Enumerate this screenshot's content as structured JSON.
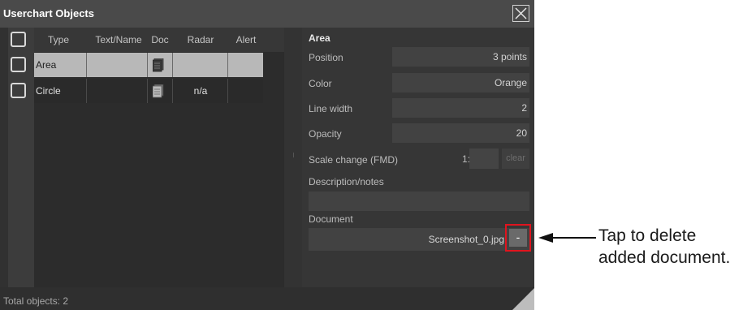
{
  "dialog": {
    "title": "Userchart Objects",
    "footer": {
      "total_label": "Total objects: 2"
    }
  },
  "table": {
    "columns": [
      "Type",
      "Text/Name",
      "Doc",
      "Radar",
      "Alert"
    ],
    "sort_indicator": "-",
    "rows": [
      {
        "type": "Area",
        "text_name": "",
        "doc_icon": "document-icon",
        "radar": "",
        "alert": "",
        "selected": true
      },
      {
        "type": "Circle",
        "text_name": "",
        "doc_icon": "document-icon",
        "radar": "n/a",
        "alert": "",
        "selected": false
      }
    ]
  },
  "details": {
    "section_title": "Area",
    "position": {
      "label": "Position",
      "value": "3 points"
    },
    "color": {
      "label": "Color",
      "value": "Orange"
    },
    "line_width": {
      "label": "Line width",
      "value": "2"
    },
    "opacity": {
      "label": "Opacity",
      "value": "20"
    },
    "scale_change": {
      "label": "Scale change (FMD)",
      "prefix": "1:",
      "value": "",
      "clear_label": "clear"
    },
    "description": {
      "label": "Description/notes",
      "value": ""
    },
    "document": {
      "label": "Document",
      "filename": "Screenshot_0.jpg",
      "delete_label": "-"
    }
  },
  "annotation": {
    "line1": "Tap to delete",
    "line2": "added document."
  },
  "colors": {
    "dialog_bg": "#313131",
    "selected_row": "#b8b8b8",
    "highlight_box": "#e0141e"
  }
}
